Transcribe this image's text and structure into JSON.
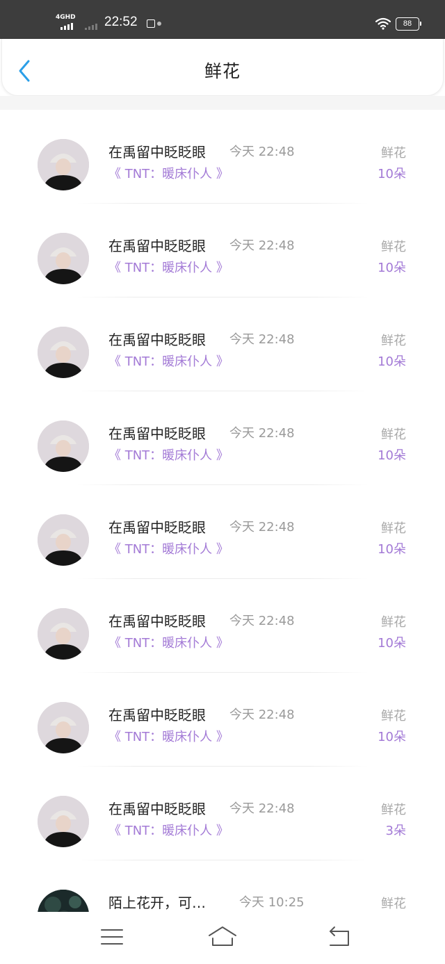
{
  "status_bar": {
    "network": "4GHD",
    "time": "22:52",
    "battery": "88"
  },
  "header": {
    "title": "鲜花"
  },
  "rows": [
    {
      "name": "在禹留中眨眨眼",
      "time": "今天 22:48",
      "book": "《 TNT：暖床仆人 》",
      "gift": "鲜花",
      "count": "10朵"
    },
    {
      "name": "在禹留中眨眨眼",
      "time": "今天 22:48",
      "book": "《 TNT：暖床仆人 》",
      "gift": "鲜花",
      "count": "10朵"
    },
    {
      "name": "在禹留中眨眨眼",
      "time": "今天 22:48",
      "book": "《 TNT：暖床仆人 》",
      "gift": "鲜花",
      "count": "10朵"
    },
    {
      "name": "在禹留中眨眨眼",
      "time": "今天 22:48",
      "book": "《 TNT：暖床仆人 》",
      "gift": "鲜花",
      "count": "10朵"
    },
    {
      "name": "在禹留中眨眨眼",
      "time": "今天 22:48",
      "book": "《 TNT：暖床仆人 》",
      "gift": "鲜花",
      "count": "10朵"
    },
    {
      "name": "在禹留中眨眨眼",
      "time": "今天 22:48",
      "book": "《 TNT：暖床仆人 》",
      "gift": "鲜花",
      "count": "10朵"
    },
    {
      "name": "在禹留中眨眨眼",
      "time": "今天 22:48",
      "book": "《 TNT：暖床仆人 》",
      "gift": "鲜花",
      "count": "10朵"
    },
    {
      "name": "在禹留中眨眨眼",
      "time": "今天 22:48",
      "book": "《 TNT：暖床仆人 》",
      "gift": "鲜花",
      "count": "3朵"
    },
    {
      "name": "陌上花开，可…",
      "time": "今天 10:25",
      "book": "",
      "gift": "鲜花",
      "count": ""
    }
  ],
  "colors": {
    "accent_purple": "#a37ad6",
    "back_arrow_blue": "#2b9fe8",
    "status_bar_bg": "#3d3d3d"
  },
  "icons": {
    "back": "chevron-left-icon",
    "menu": "menu-icon",
    "home": "home-icon",
    "return": "return-icon"
  }
}
